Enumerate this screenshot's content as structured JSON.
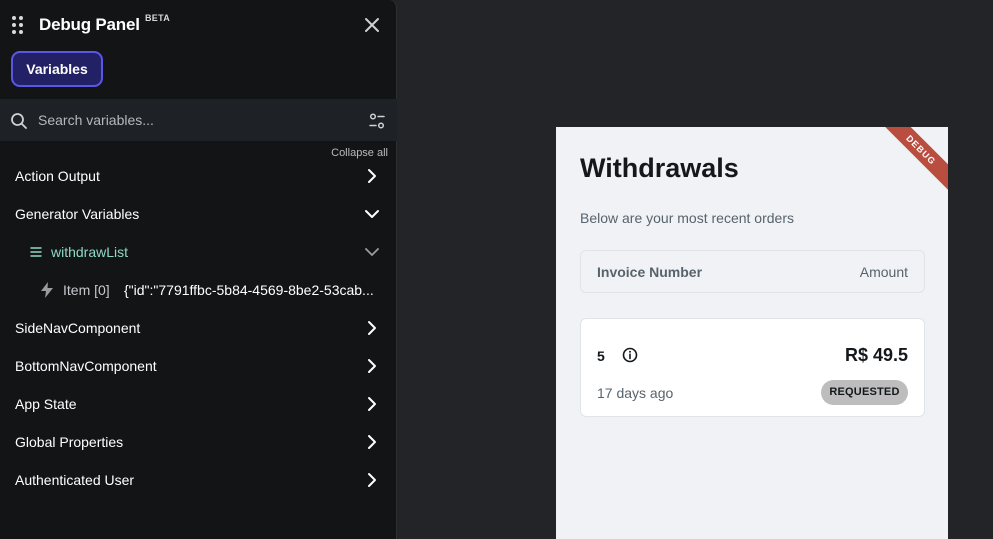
{
  "debug_panel": {
    "title": "Debug Panel",
    "beta_tag": "BETA",
    "tabs": [
      {
        "label": "Variables",
        "active": true
      }
    ],
    "search": {
      "placeholder": "Search variables...",
      "value": ""
    },
    "collapse_all_label": "Collapse all",
    "tree": [
      {
        "label": "Action Output",
        "expanded": false
      },
      {
        "label": "Generator Variables",
        "expanded": true
      },
      {
        "label": "withdrawList",
        "expanded": true,
        "icon": "list-icon"
      },
      {
        "label": "Item [0]",
        "value": "{\"id\":\"7791ffbc-5b84-4569-8be2-53cab...",
        "icon": "bolt-icon"
      },
      {
        "label": "SideNavComponent",
        "expanded": false
      },
      {
        "label": "BottomNavComponent",
        "expanded": false
      },
      {
        "label": "App State",
        "expanded": false
      },
      {
        "label": "Global Properties",
        "expanded": false
      },
      {
        "label": "Authenticated User",
        "expanded": false
      }
    ]
  },
  "preview": {
    "ribbon": "DEBUG",
    "title": "Withdrawals",
    "subtitle": "Below are your most recent orders",
    "table_header": {
      "invoice": "Invoice Number",
      "amount": "Amount"
    },
    "orders": [
      {
        "id": "5",
        "amount": "R$ 49.5",
        "time": "17 days ago",
        "status": "REQUESTED"
      }
    ]
  },
  "colors": {
    "panel_bg": "#131416",
    "accent": "#5b57e6",
    "list_accent": "#8fd9c7",
    "preview_bg": "#f1f2f6",
    "ribbon": "#b94d3f",
    "status_badge": "#bdbdbd"
  }
}
